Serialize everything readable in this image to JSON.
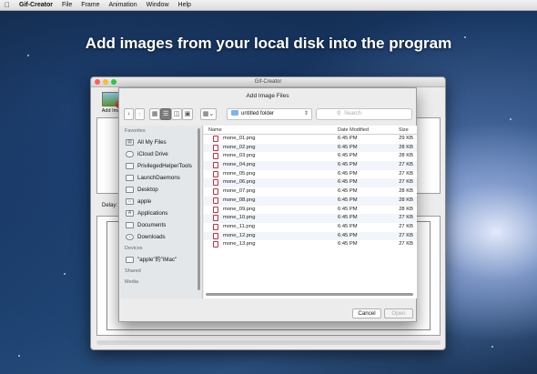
{
  "menubar": {
    "app_name": "Gif-Creator",
    "items": [
      "File",
      "Frame",
      "Animation",
      "Window",
      "Help"
    ]
  },
  "headline": "Add images from your local disk into the program",
  "app_window": {
    "title": "Gif-Creator",
    "add_image_label": "Add Ima",
    "delay_label": "Delay:"
  },
  "dialog": {
    "title": "Add Image Files",
    "folder": "untitled folder",
    "search_placeholder": "Search",
    "columns": {
      "name": "Name",
      "date": "Date Modified",
      "size": "Size"
    },
    "files": [
      {
        "name": "mone_01.png",
        "date": "6:45 PM",
        "size": "29 KB"
      },
      {
        "name": "mone_02.png",
        "date": "6:45 PM",
        "size": "28 KB"
      },
      {
        "name": "mone_03.png",
        "date": "6:45 PM",
        "size": "28 KB"
      },
      {
        "name": "mone_04.png",
        "date": "6:45 PM",
        "size": "27 KB"
      },
      {
        "name": "mone_05.png",
        "date": "6:45 PM",
        "size": "27 KB"
      },
      {
        "name": "mone_06.png",
        "date": "6:45 PM",
        "size": "27 KB"
      },
      {
        "name": "mone_07.png",
        "date": "6:45 PM",
        "size": "28 KB"
      },
      {
        "name": "mone_08.png",
        "date": "6:45 PM",
        "size": "28 KB"
      },
      {
        "name": "mone_09.png",
        "date": "6:45 PM",
        "size": "28 KB"
      },
      {
        "name": "mone_10.png",
        "date": "6:45 PM",
        "size": "27 KB"
      },
      {
        "name": "mone_11.png",
        "date": "6:45 PM",
        "size": "27 KB"
      },
      {
        "name": "mone_12.png",
        "date": "6:45 PM",
        "size": "27 KB"
      },
      {
        "name": "mone_13.png",
        "date": "6:45 PM",
        "size": "27 KB"
      }
    ],
    "sidebar": {
      "favorites_heading": "Favorites",
      "favorites": [
        {
          "label": "All My Files",
          "icon": "all-files-icon"
        },
        {
          "label": "iCloud Drive",
          "icon": "cloud-icon"
        },
        {
          "label": "PrivilegedHelperTools",
          "icon": "folder-icon"
        },
        {
          "label": "LaunchDaemons",
          "icon": "folder-icon"
        },
        {
          "label": "Desktop",
          "icon": "desktop-icon"
        },
        {
          "label": "apple",
          "icon": "home-icon"
        },
        {
          "label": "Applications",
          "icon": "applications-icon"
        },
        {
          "label": "Documents",
          "icon": "document-icon"
        },
        {
          "label": "Downloads",
          "icon": "download-icon"
        }
      ],
      "devices_heading": "Devices",
      "devices": [
        {
          "label": "\"apple\"的\"iMac\"",
          "icon": "computer-icon"
        }
      ],
      "shared_heading": "Shared",
      "media_heading": "Media"
    },
    "buttons": {
      "cancel": "Cancel",
      "open": "Open"
    }
  }
}
